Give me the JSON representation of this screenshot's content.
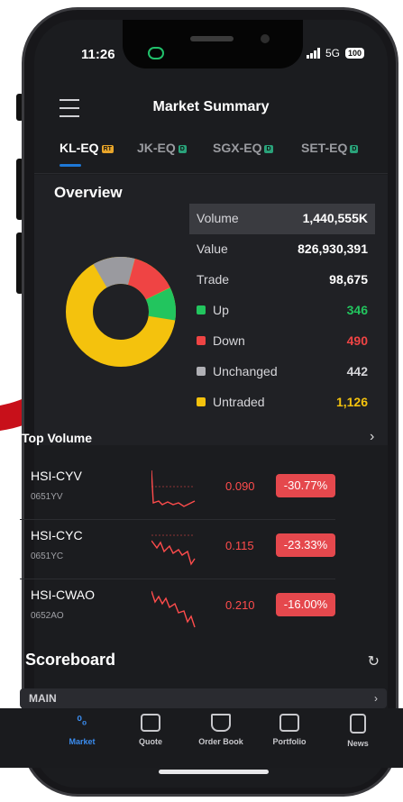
{
  "status": {
    "time": "11:26",
    "network": "5G",
    "battery": "100"
  },
  "header": {
    "title": "Market Summary"
  },
  "tabs": [
    {
      "label": "KL-EQ",
      "tag": "RT"
    },
    {
      "label": "JK-EQ",
      "tag": "D"
    },
    {
      "label": "SGX-EQ",
      "tag": "D"
    },
    {
      "label": "SET-EQ",
      "tag": "D"
    }
  ],
  "overview": {
    "title": "Overview",
    "rows": [
      {
        "label": "Volume",
        "value": "1,440,555K"
      },
      {
        "label": "Value",
        "value": "826,930,391"
      },
      {
        "label": "Trade",
        "value": "98,675"
      },
      {
        "label": "Up",
        "value": "346",
        "color": "#22c55e"
      },
      {
        "label": "Down",
        "value": "490",
        "color": "#ef4444"
      },
      {
        "label": "Unchanged",
        "value": "442",
        "color": "#b0b0b5"
      },
      {
        "label": "Untraded",
        "value": "1,126",
        "color": "#f4c20d"
      }
    ]
  },
  "top_volume": {
    "title": "Top Volume",
    "items": [
      {
        "name": "HSI-CYV",
        "code": "0651YV",
        "price": "0.090",
        "change": "-30.77%"
      },
      {
        "name": "HSI-CYC",
        "code": "0651YC",
        "price": "0.115",
        "change": "-23.33%"
      },
      {
        "name": "HSI-CWAO",
        "code": "0652AO",
        "price": "0.210",
        "change": "-16.00%"
      }
    ]
  },
  "scoreboard": {
    "title": "Scoreboard",
    "main_label": "MAIN"
  },
  "nav": [
    {
      "label": "Market",
      "icon": "market-icon"
    },
    {
      "label": "Quote",
      "icon": "quote-icon"
    },
    {
      "label": "Order Book",
      "icon": "order-book-icon"
    },
    {
      "label": "Portfolio",
      "icon": "portfolio-icon"
    },
    {
      "label": "News",
      "icon": "news-icon"
    }
  ],
  "colors": {
    "accent": "#1e78d6",
    "down": "#e5484d",
    "up": "#22c55e",
    "annotation_arrow": "#c8101a"
  }
}
